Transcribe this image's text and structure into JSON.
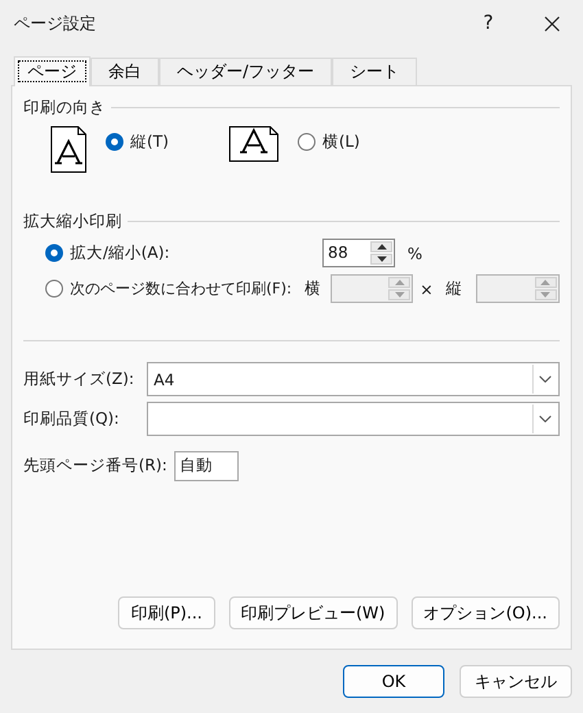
{
  "window": {
    "title": "ページ設定",
    "help": "?"
  },
  "tabs": [
    {
      "label": "ページ",
      "selected": true
    },
    {
      "label": "余白",
      "selected": false
    },
    {
      "label": "ヘッダー/フッター",
      "selected": false
    },
    {
      "label": "シート",
      "selected": false
    }
  ],
  "orientation": {
    "title": "印刷の向き",
    "options": [
      {
        "kind": "portrait",
        "label": "縦(T)",
        "selected": true
      },
      {
        "kind": "landscape",
        "label": "横(L)",
        "selected": false
      }
    ]
  },
  "scaling": {
    "title": "拡大縮小印刷",
    "adjust": {
      "label": "拡大/縮小(A):",
      "selected": true,
      "value": "88",
      "unit": "%"
    },
    "fit": {
      "label": "次のページ数に合わせて印刷(F):",
      "selected": false,
      "wide_label": "横",
      "separator": "×",
      "tall_label": "縦"
    }
  },
  "paper_size": {
    "label": "用紙サイズ(Z):",
    "value": "A4"
  },
  "print_quality": {
    "label": "印刷品質(Q):"
  },
  "first_page_number": {
    "label": "先頭ページ番号(R):",
    "value": "自動"
  },
  "panel_buttons": [
    "印刷(P)...",
    "印刷プレビュー(W)",
    "オプション(O)..."
  ],
  "dialog_buttons": [
    {
      "label": "OK",
      "default": true
    },
    {
      "label": "キャンセル",
      "default": false
    }
  ]
}
